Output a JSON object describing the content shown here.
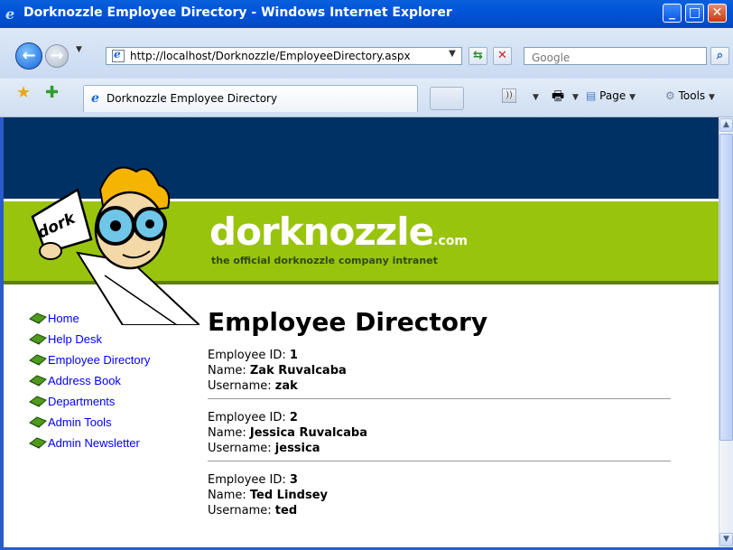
{
  "window": {
    "title": "Dorknozzle Employee Directory - Windows Internet Explorer"
  },
  "address": {
    "url": "http://localhost/Dorknozzle/EmployeeDirectory.aspx"
  },
  "search": {
    "placeholder": "Google"
  },
  "tab": {
    "label": "Dorknozzle Employee Directory"
  },
  "commands": {
    "page": "Page",
    "tools": "Tools"
  },
  "site": {
    "brand": "dorknozzle",
    "brand_suffix": ".com",
    "tagline": "the official dorknozzle company intranet",
    "mascot_sign": "dork"
  },
  "nav": {
    "items": [
      {
        "label": "Home"
      },
      {
        "label": "Help Desk"
      },
      {
        "label": "Employee Directory"
      },
      {
        "label": "Address Book"
      },
      {
        "label": "Departments"
      },
      {
        "label": "Admin Tools"
      },
      {
        "label": "Admin Newsletter"
      }
    ]
  },
  "main": {
    "heading": "Employee Directory",
    "labels": {
      "id": "Employee ID:",
      "name": "Name:",
      "username": "Username:"
    },
    "employees": [
      {
        "id": "1",
        "name": "Zak Ruvalcaba",
        "username": "zak"
      },
      {
        "id": "2",
        "name": "Jessica Ruvalcaba",
        "username": "jessica"
      },
      {
        "id": "3",
        "name": "Ted Lindsey",
        "username": "ted"
      }
    ]
  },
  "colors": {
    "titlebar_blue": "#0254D8",
    "header_navy": "#003164",
    "header_green": "#99C40D",
    "link_blue": "#0000FF"
  }
}
